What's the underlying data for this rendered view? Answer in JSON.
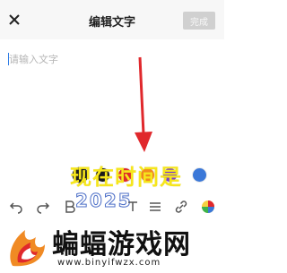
{
  "header": {
    "title": "编辑文字",
    "done_label": "完成"
  },
  "editor": {
    "placeholder": "请输入文字"
  },
  "palette": {
    "colors": [
      "#1e1e1e",
      "#1a1a1a",
      "#e02a2a",
      "#f28a1e",
      "#7b3fcf",
      "#3b78d8"
    ],
    "selected_index": 0
  },
  "toolbar": {
    "tools": [
      "undo-icon",
      "redo-icon",
      "bold-icon",
      "text-color-icon",
      "align-icon",
      "link-icon",
      "color-wheel-icon"
    ]
  },
  "overlay": {
    "yellow_text": "现在时间是",
    "partial_text": "2025",
    "arrow_color": "#e0282c"
  },
  "watermark": {
    "title": "蝙蝠游戏网",
    "url": "www.binyifwzx.com"
  }
}
